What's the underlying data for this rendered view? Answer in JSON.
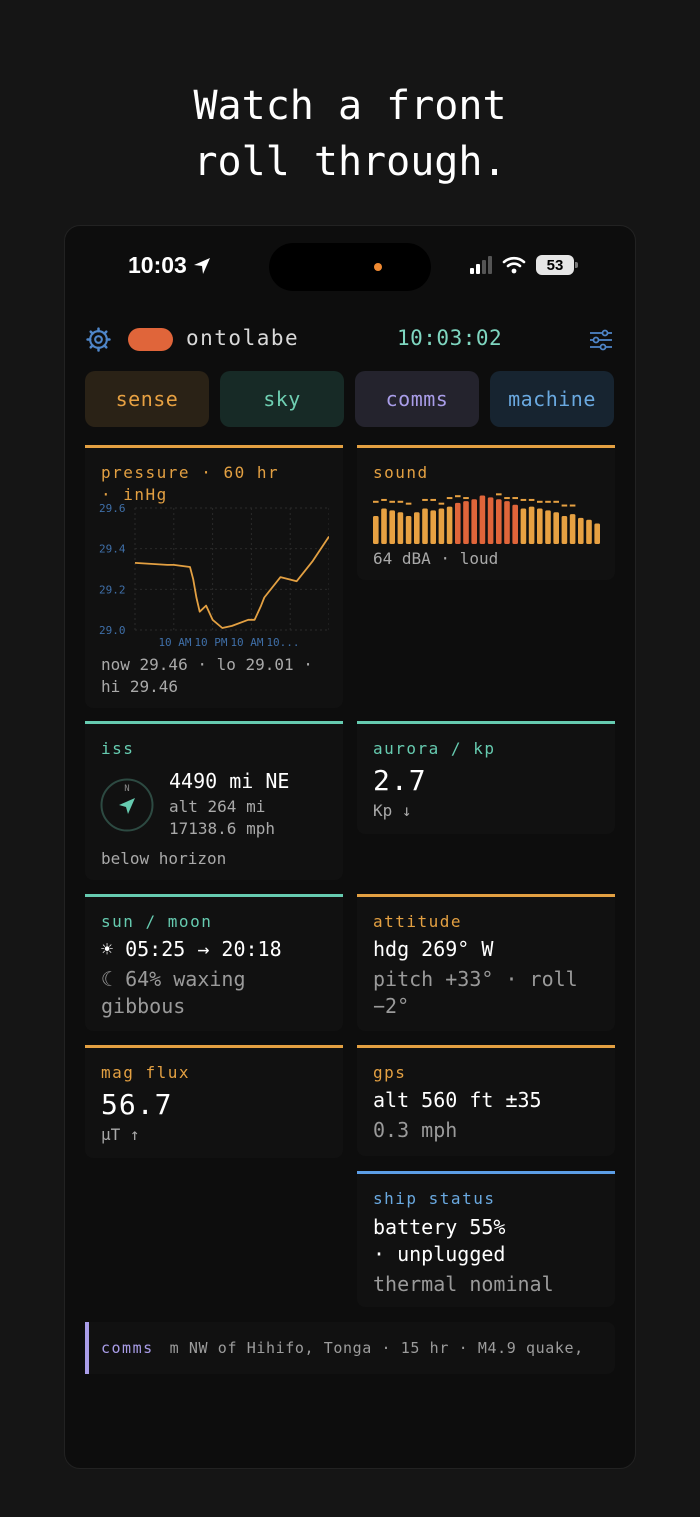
{
  "headline": {
    "line1": "Watch a front",
    "line2": "roll through."
  },
  "status_bar": {
    "time": "10:03",
    "battery": "53"
  },
  "header": {
    "app_name": "ontolabe",
    "clock": "10:03:02"
  },
  "tabs": [
    {
      "label": "sense",
      "color": "#e7a142"
    },
    {
      "label": "sky",
      "color": "#6fcfb2"
    },
    {
      "label": "comms",
      "color": "#a99de8"
    },
    {
      "label": "machine",
      "color": "#6aa9e0"
    }
  ],
  "pressure": {
    "label_line1": "pressure · 60 hr",
    "label_line2": "· inHg",
    "summary_line1": "now 29.46 · lo 29.01 ·",
    "summary_line2": "hi 29.46"
  },
  "sound": {
    "label": "sound",
    "reading": "64 dBA · loud"
  },
  "iss": {
    "label": "iss",
    "compass_n": "N",
    "distance": "4490 mi NE",
    "altitude": "alt 264 mi",
    "speed": "17138.6 mph",
    "visibility": "below horizon"
  },
  "aurora": {
    "label": "aurora / kp",
    "value": "2.7",
    "unit": "Kp ↓"
  },
  "sun_moon": {
    "label": "sun / moon",
    "sun": "☀ 05:25 → 20:18",
    "moon_line1": "☾ 64% waxing",
    "moon_line2": "gibbous"
  },
  "attitude": {
    "label": "attitude",
    "heading": "hdg 269° W",
    "line2": "pitch +33° · roll",
    "line3": "−2°"
  },
  "mag_flux": {
    "label": "mag flux",
    "value": "56.7",
    "unit": "µT ↑"
  },
  "gps": {
    "label": "gps",
    "altitude": "alt 560 ft ±35",
    "speed": "0.3 mph"
  },
  "ship_status": {
    "label": "ship status",
    "line1": "battery 55%",
    "line2": "· unplugged",
    "line3": "thermal nominal"
  },
  "ticker": {
    "label": "comms",
    "text": "m NW of Hihifo, Tonga · 15 hr   ·   M4.9 quake,"
  },
  "chart_data": [
    {
      "type": "line",
      "title": "pressure · 60 hr · inHg",
      "ylim": [
        29.0,
        29.6
      ],
      "y_ticks": [
        "29.6",
        "29.4",
        "29.2",
        "29.0"
      ],
      "x_ticks": [
        "10 AM",
        "10 PM",
        "10 AM",
        "10..."
      ],
      "x_hours": [
        0,
        10,
        12,
        17,
        18,
        19,
        20,
        22,
        24,
        27,
        30,
        35,
        37,
        39,
        40,
        45,
        50,
        55,
        60
      ],
      "values": [
        29.33,
        29.32,
        29.32,
        29.31,
        29.25,
        29.16,
        29.09,
        29.12,
        29.05,
        29.01,
        29.02,
        29.05,
        29.05,
        29.12,
        29.16,
        29.26,
        29.24,
        29.34,
        29.46
      ],
      "grid": true
    },
    {
      "type": "bar",
      "title": "sound",
      "values": [
        40,
        44,
        43,
        42,
        40,
        42,
        44,
        43,
        44,
        45,
        47,
        48,
        49,
        51,
        50,
        49,
        48,
        46,
        44,
        45,
        44,
        43,
        42,
        40,
        41,
        39,
        38,
        36,
        35
      ],
      "peaks": [
        46,
        47,
        46,
        46,
        45,
        null,
        47,
        47,
        45,
        48,
        49,
        48,
        null,
        null,
        null,
        50,
        48,
        48,
        47,
        47,
        46,
        46,
        46,
        44,
        44
      ],
      "colors": {
        "low": "#e7a142",
        "high": "#e0653a"
      }
    }
  ]
}
